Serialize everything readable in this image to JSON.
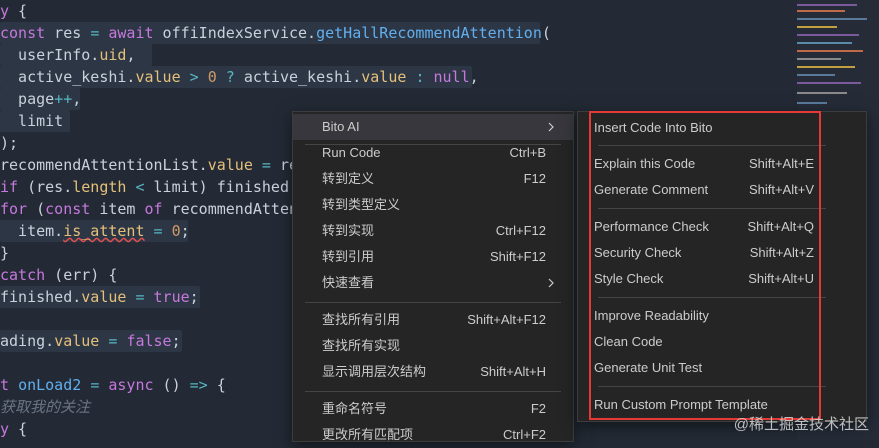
{
  "code_lines": [
    {
      "text": "y {"
    },
    {
      "text": "const res = await offiIndexService.getHallRecommendAttention("
    },
    {
      "text": "  userInfo.uid,"
    },
    {
      "text": "  active_keshi.value > 0 ? active_keshi.value : null,"
    },
    {
      "text": "  page++,"
    },
    {
      "text": "  limit"
    },
    {
      "text": ");"
    },
    {
      "text": "recommendAttentionList.value = rec"
    },
    {
      "text": "if (res.length < limit) finished.v"
    },
    {
      "text": "for (const item of recommendAttent"
    },
    {
      "text": "  item.is_attent = 0;"
    },
    {
      "text": "}"
    },
    {
      "text": "catch (err) {"
    },
    {
      "text": "finished.value = true;"
    },
    {
      "text": ""
    },
    {
      "text": "ading.value = false;"
    },
    {
      "text": ""
    },
    {
      "text": "t onLoad2 = async () => {"
    },
    {
      "text": "获取我的关注"
    },
    {
      "text": "y {"
    }
  ],
  "context_menu": {
    "items": [
      {
        "label": "Bito AI",
        "shortcut": "",
        "submenu": true
      },
      {
        "label": "Run Code",
        "shortcut": "Ctrl+B"
      },
      {
        "label": "转到定义",
        "shortcut": "F12"
      },
      {
        "label": "转到类型定义",
        "shortcut": ""
      },
      {
        "label": "转到实现",
        "shortcut": "Ctrl+F12"
      },
      {
        "label": "转到引用",
        "shortcut": "Shift+F12"
      },
      {
        "label": "快速查看",
        "shortcut": "",
        "submenu": true
      },
      {
        "label": "查找所有引用",
        "shortcut": "Shift+Alt+F12"
      },
      {
        "label": "查找所有实现",
        "shortcut": ""
      },
      {
        "label": "显示调用层次结构",
        "shortcut": "Shift+Alt+H"
      },
      {
        "label": "重命名符号",
        "shortcut": "F2"
      },
      {
        "label": "更改所有匹配项",
        "shortcut": "Ctrl+F2"
      }
    ]
  },
  "bito_submenu": {
    "items": [
      {
        "label": "Insert Code Into Bito",
        "shortcut": ""
      },
      {
        "label": "Explain this Code",
        "shortcut": "Shift+Alt+E"
      },
      {
        "label": "Generate Comment",
        "shortcut": "Shift+Alt+V"
      },
      {
        "label": "Performance Check",
        "shortcut": "Shift+Alt+Q"
      },
      {
        "label": "Security Check",
        "shortcut": "Shift+Alt+Z"
      },
      {
        "label": "Style Check",
        "shortcut": "Shift+Alt+U"
      },
      {
        "label": "Improve Readability",
        "shortcut": ""
      },
      {
        "label": "Clean Code",
        "shortcut": ""
      },
      {
        "label": "Generate Unit Test",
        "shortcut": ""
      },
      {
        "label": "Run Custom Prompt Template",
        "shortcut": ""
      }
    ]
  },
  "icons": {
    "submenu_arrow": "chevron-right-icon"
  },
  "watermark": "@稀土掘金技术社区",
  "colors": {
    "highlight_box": "#e53935",
    "menu_bg": "#252526"
  }
}
